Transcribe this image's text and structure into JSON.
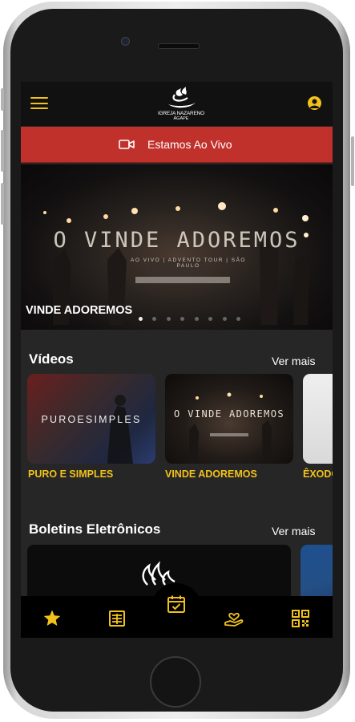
{
  "app": {
    "brand_line1": "IGREJA NAZARENO",
    "brand_line2": "ÁGAPE"
  },
  "live_banner": {
    "label": "Estamos Ao Vivo",
    "color": "#c1312c"
  },
  "hero": {
    "title": "O VINDE ADOREMOS",
    "subtitle": "AO VIVO | ADVENTO TOUR | SÃO PAULO",
    "caption": "VINDE ADOREMOS",
    "slide_count": 8,
    "active_slide": 1
  },
  "videos": {
    "title": "Vídeos",
    "more_label": "Ver mais",
    "items": [
      {
        "label": "PURO E SIMPLES",
        "thumb_text": "PUROESIMPLES"
      },
      {
        "label": "VINDE ADOREMOS",
        "thumb_text": "O VINDE ADOREMOS"
      },
      {
        "label": "ÊXODO",
        "thumb_text": ""
      }
    ]
  },
  "bulletins": {
    "title": "Boletins Eletrônicos",
    "more_label": "Ver mais"
  },
  "bottom_nav": {
    "items": [
      "star-icon",
      "book-icon",
      "calendar-check-icon",
      "hand-heart-icon",
      "qr-code-icon"
    ]
  },
  "colors": {
    "accent": "#f2c21b",
    "background": "#262626",
    "live": "#c1312c"
  }
}
